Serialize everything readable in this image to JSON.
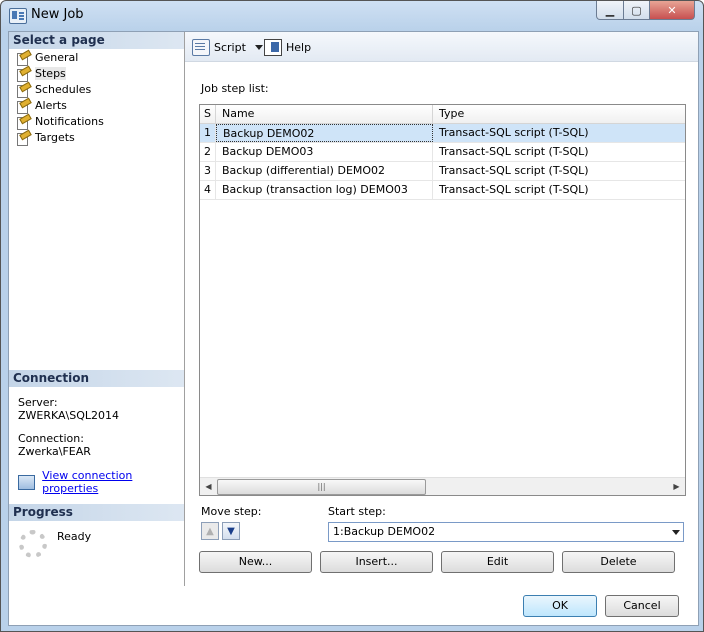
{
  "window": {
    "title": "New Job"
  },
  "left_pane": {
    "select_page_header": "Select a page",
    "pages": [
      {
        "label": "General",
        "selected": false
      },
      {
        "label": "Steps",
        "selected": true
      },
      {
        "label": "Schedules",
        "selected": false
      },
      {
        "label": "Alerts",
        "selected": false
      },
      {
        "label": "Notifications",
        "selected": false
      },
      {
        "label": "Targets",
        "selected": false
      }
    ],
    "connection_header": "Connection",
    "server_label": "Server:",
    "server_value": "ZWERKA\\SQL2014",
    "connection_label": "Connection:",
    "connection_value": "Zwerka\\FEAR",
    "view_connection_link": "View connection properties",
    "progress_header": "Progress",
    "progress_status": "Ready"
  },
  "toolbar": {
    "script_label": "Script",
    "help_label": "Help"
  },
  "steps": {
    "list_label": "Job step list:",
    "columns": [
      "S",
      "Name",
      "Type"
    ],
    "rows": [
      {
        "s": "1",
        "name": "Backup DEMO02",
        "type": "Transact-SQL script (T-SQL)",
        "selected": true
      },
      {
        "s": "2",
        "name": "Backup DEMO03",
        "type": "Transact-SQL script (T-SQL)",
        "selected": false
      },
      {
        "s": "3",
        "name": "Backup (differential) DEMO02",
        "type": "Transact-SQL script (T-SQL)",
        "selected": false
      },
      {
        "s": "4",
        "name": "Backup (transaction log) DEMO03",
        "type": "Transact-SQL script (T-SQL)",
        "selected": false
      }
    ],
    "move_step_label": "Move step:",
    "start_step_label": "Start step:",
    "start_step_value": "1:Backup DEMO02",
    "new_button": "New...",
    "insert_button": "Insert...",
    "edit_button": "Edit",
    "delete_button": "Delete"
  },
  "footer": {
    "ok_label": "OK",
    "cancel_label": "Cancel"
  },
  "colors": {
    "selected_row": "#cfe4f8",
    "section_header": "#c4d5e8",
    "link": "#0000ee",
    "title_bar": "#b9d1ea"
  }
}
